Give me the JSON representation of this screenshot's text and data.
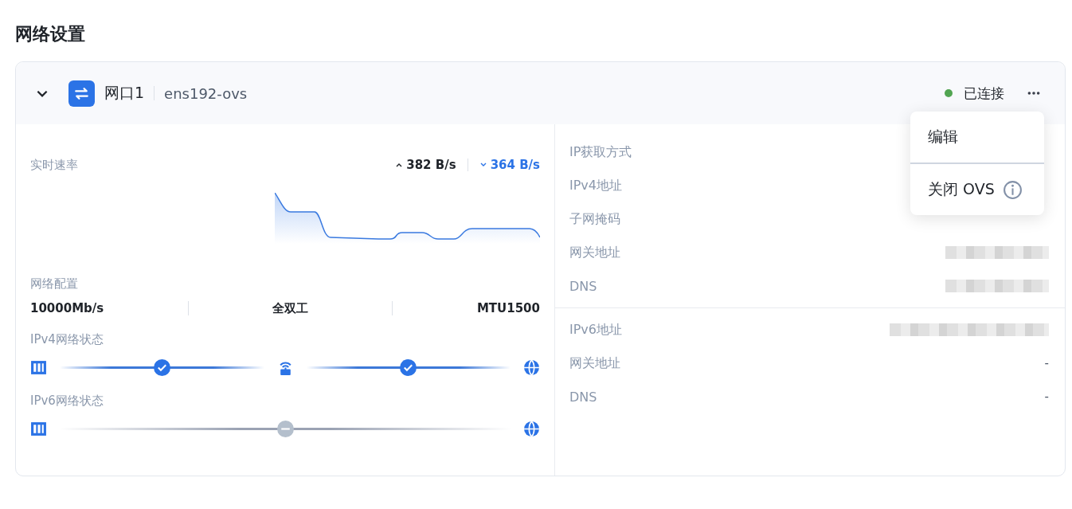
{
  "page_title": "网络设置",
  "port": {
    "expanded": true,
    "name": "网口1",
    "device": "ens192-ovs",
    "status": {
      "label": "已连接",
      "connected": true
    }
  },
  "menu": {
    "items": [
      {
        "label": "编辑",
        "info": false
      },
      {
        "label": "关闭 OVS",
        "info": true
      }
    ]
  },
  "realtime": {
    "label": "实时速率",
    "upload": "382 B/s",
    "download": "364 B/s"
  },
  "config": {
    "label": "网络配置",
    "items": [
      "10000Mb/s",
      "全双工",
      "MTU1500"
    ]
  },
  "link_status": [
    {
      "label": "IPv4网络状态",
      "path": [
        {
          "kind": "host"
        },
        {
          "kind": "link",
          "ok": true
        },
        {
          "kind": "router"
        },
        {
          "kind": "link",
          "ok": true
        },
        {
          "kind": "internet"
        }
      ]
    },
    {
      "label": "IPv6网络状态",
      "path": [
        {
          "kind": "host"
        },
        {
          "kind": "link",
          "ok": false
        },
        {
          "kind": "internet"
        }
      ]
    }
  ],
  "details": [
    {
      "rows": [
        {
          "label": "IP获取方式",
          "redacted": false
        },
        {
          "label": "IPv4地址",
          "redacted": false
        },
        {
          "label": "子网掩码",
          "redacted": false
        },
        {
          "label": "网关地址",
          "redacted": true
        },
        {
          "label": "DNS",
          "redacted": true
        }
      ]
    },
    {
      "rows": [
        {
          "label": "IPv6地址",
          "redacted": true
        },
        {
          "label": "网关地址",
          "value": "-",
          "redacted": false
        },
        {
          "label": "DNS",
          "value": "-",
          "redacted": false
        }
      ]
    }
  ]
}
